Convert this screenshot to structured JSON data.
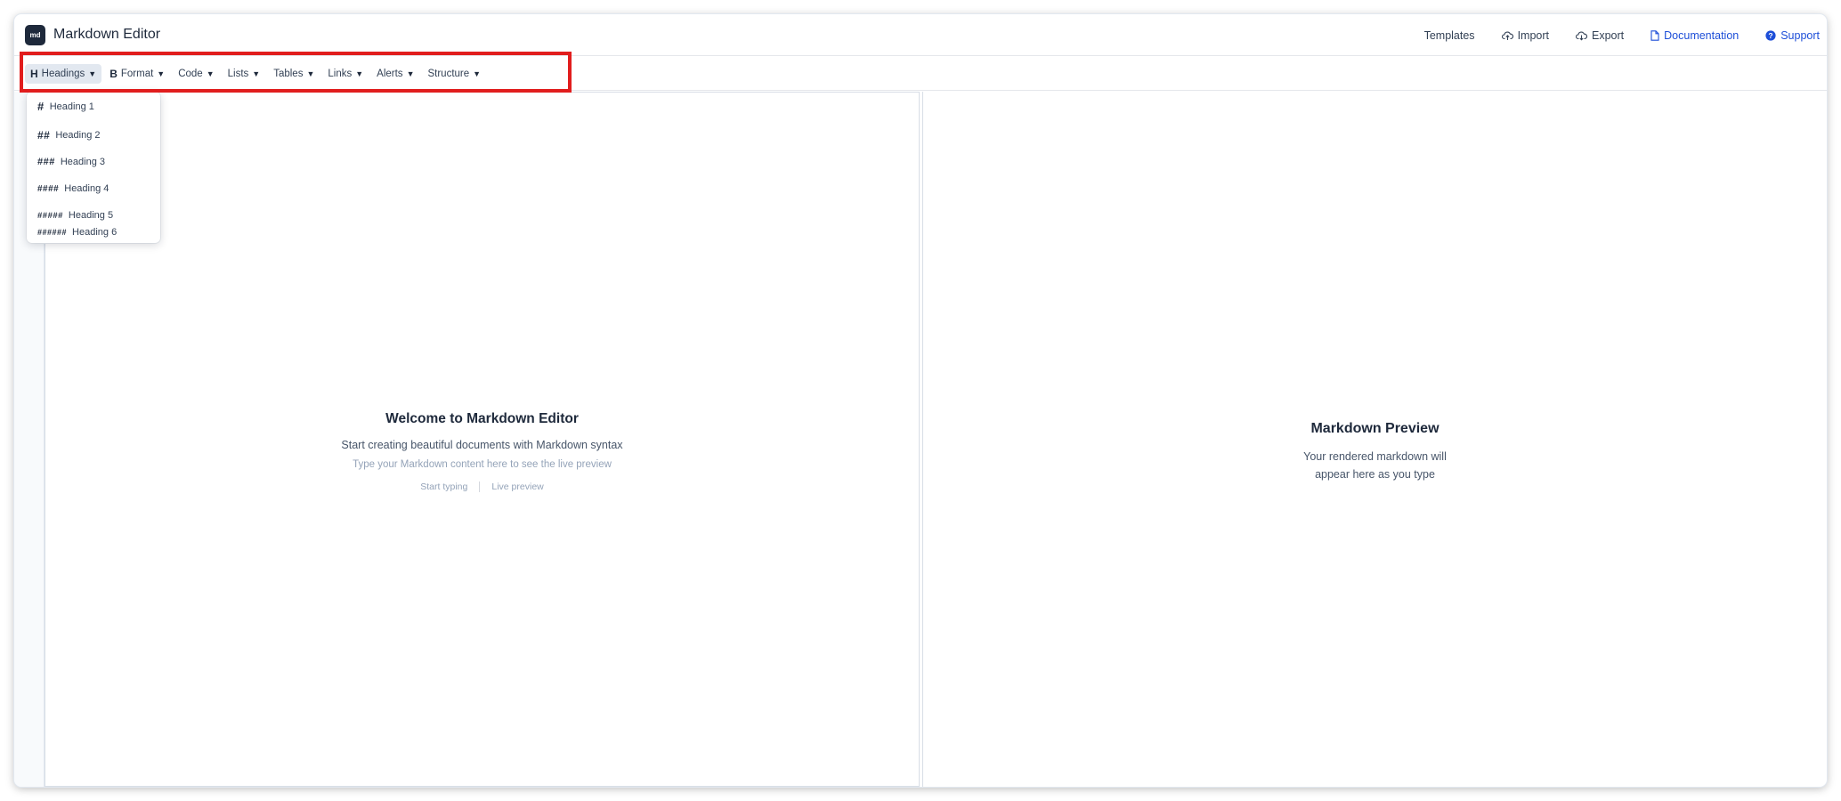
{
  "app": {
    "logo_text": "md",
    "title": "Markdown Editor"
  },
  "top_nav": {
    "templates": "Templates",
    "import": "Import",
    "export": "Export",
    "documentation": "Documentation",
    "support": "Support"
  },
  "toolbar": {
    "menus": [
      {
        "icon": "H",
        "label": "Headings",
        "caret": "▼"
      },
      {
        "icon": "B",
        "label": "Format",
        "caret": "▼"
      },
      {
        "icon": "",
        "label": "Code",
        "caret": "▼"
      },
      {
        "icon": "",
        "label": "Lists",
        "caret": "▼"
      },
      {
        "icon": "",
        "label": "Tables",
        "caret": "▼"
      },
      {
        "icon": "",
        "label": "Links",
        "caret": "▼"
      },
      {
        "icon": "",
        "label": "Alerts",
        "caret": "▼"
      },
      {
        "icon": "",
        "label": "Structure",
        "caret": "▼"
      }
    ]
  },
  "headings_menu": {
    "items": [
      {
        "hash": "#",
        "label": "Heading 1"
      },
      {
        "hash": "##",
        "label": "Heading 2"
      },
      {
        "hash": "###",
        "label": "Heading 3"
      },
      {
        "hash": "####",
        "label": "Heading 4"
      },
      {
        "hash": "#####",
        "label": "Heading 5"
      },
      {
        "hash": "######",
        "label": "Heading 6"
      }
    ]
  },
  "editor": {
    "welcome_title": "Welcome to Markdown Editor",
    "welcome_subtitle": "Start creating beautiful documents with Markdown syntax",
    "welcome_hint": "Type your Markdown content here to see the live preview",
    "tag_start": "Start typing",
    "tag_preview": "Live preview"
  },
  "preview": {
    "title": "Markdown Preview",
    "description": "Your rendered markdown will appear here as you type"
  },
  "colors": {
    "accent": "#1d4ed8",
    "highlight": "#e11d1d",
    "logo_bg": "#1e293b"
  }
}
